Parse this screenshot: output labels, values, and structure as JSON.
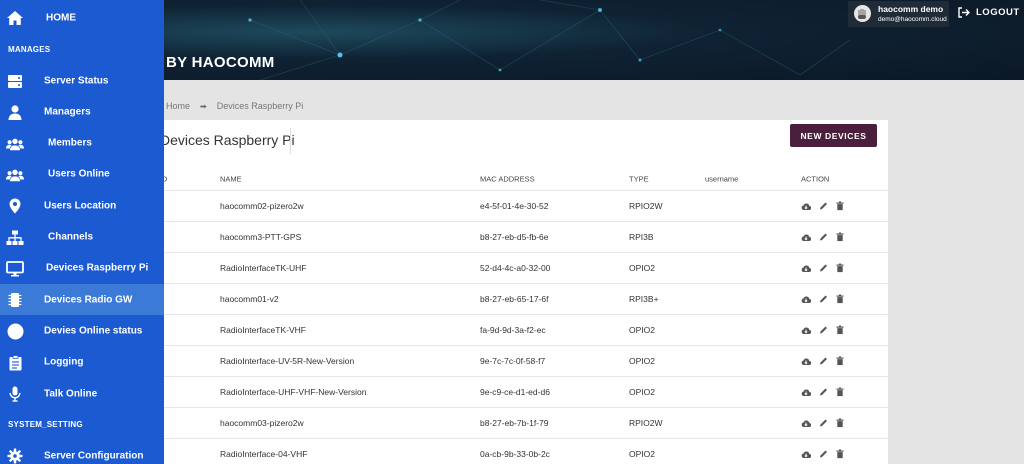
{
  "header": {
    "brand": "BY HAOCOMM",
    "user_name": "haocomm demo",
    "user_email": "demo@haocomm.cloud",
    "logout_label": "LOGOUT"
  },
  "breadcrumb": {
    "home": "Home",
    "current": "Devices Raspberry Pi"
  },
  "page": {
    "title": "Devices Raspberry Pi",
    "new_button": "NEW DEVICES"
  },
  "table": {
    "columns": {
      "no": "NO",
      "name": "NAME",
      "mac": "MAC ADDRESS",
      "type": "TYPE",
      "username": "username",
      "action": "ACTION"
    },
    "rows": [
      {
        "name": "haocomm02-pizero2w",
        "mac": "e4-5f-01-4e-30-52",
        "type": "RPIO2W",
        "username": ""
      },
      {
        "name": "haocomm3-PTT-GPS",
        "mac": "b8-27-eb-d5-fb-6e",
        "type": "RPI3B",
        "username": ""
      },
      {
        "name": "RadioInterfaceTK-UHF",
        "mac": "52-d4-4c-a0-32-00",
        "type": "OPIO2",
        "username": ""
      },
      {
        "name": "haocomm01-v2",
        "mac": "b8-27-eb-65-17-6f",
        "type": "RPI3B+",
        "username": ""
      },
      {
        "name": "RadioInterfaceTK-VHF",
        "mac": "fa-9d-9d-3a-f2-ec",
        "type": "OPIO2",
        "username": ""
      },
      {
        "name": "RadioInterface-UV-5R-New-Version",
        "mac": "9e-7c-7c-0f-58-f7",
        "type": "OPIO2",
        "username": ""
      },
      {
        "name": "RadioInterface-UHF-VHF-New-Version",
        "mac": "9e-c9-ce-d1-ed-d6",
        "type": "OPIO2",
        "username": ""
      },
      {
        "name": "haocomm03-pizero2w",
        "mac": "b8-27-eb-7b-1f-79",
        "type": "RPIO2W",
        "username": ""
      },
      {
        "name": "RadioInterface-04-VHF",
        "mac": "0a-cb-9b-33-0b-2c",
        "type": "OPIO2",
        "username": ""
      }
    ]
  },
  "sidebar": {
    "home": "HOME",
    "section_manages": "MANAGES",
    "items": [
      {
        "label": "Server Status",
        "icon": "server-icon"
      },
      {
        "label": "Managers",
        "icon": "user-icon"
      },
      {
        "label": "Members",
        "icon": "users-icon"
      },
      {
        "label": "Users Online",
        "icon": "users-icon"
      },
      {
        "label": "Users Location",
        "icon": "map-marker-icon"
      },
      {
        "label": "Channels",
        "icon": "sitemap-icon"
      },
      {
        "label": "Devices Raspberry Pi",
        "icon": "desktop-icon"
      },
      {
        "label": "Devices Radio GW",
        "icon": "chip-icon"
      },
      {
        "label": "Devies Online status",
        "icon": "circle-icon"
      },
      {
        "label": "Logging",
        "icon": "clipboard-icon"
      },
      {
        "label": "Talk Online",
        "icon": "microphone-icon"
      }
    ],
    "section_system": "SYSTEM_SETTING",
    "server_config": "Server Configuration"
  },
  "colors": {
    "sidebar_bg": "#1b5ad0",
    "sidebar_active": "#3c7ad7",
    "button_bg": "#4a1f3d",
    "header_bg": "#0f2233"
  }
}
